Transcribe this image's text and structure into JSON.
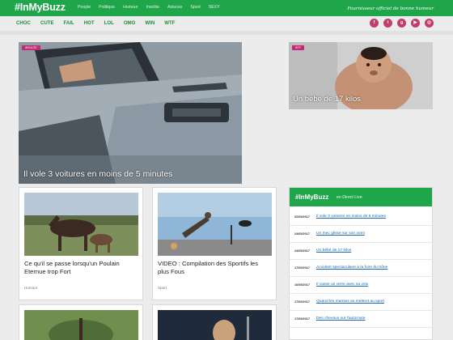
{
  "header": {
    "logo": "#InMyBuzz",
    "nav": [
      "People",
      "Politique",
      "Humour",
      "Insolite",
      "Astuces",
      "Sport",
      "SEXY"
    ],
    "tagline": "Fournisseur officiel de bonne humeur"
  },
  "subnav": [
    "CHOC",
    "CUTE",
    "FAIL",
    "HOT",
    "LOL",
    "OMG",
    "WIN",
    "WTF"
  ],
  "social": [
    {
      "icon": "facebook-icon",
      "glyph": "f"
    },
    {
      "icon": "twitter-icon",
      "glyph": "t"
    },
    {
      "icon": "googleplus-icon",
      "glyph": "g"
    },
    {
      "icon": "youtube-icon",
      "glyph": "▶"
    },
    {
      "icon": "instagram-icon",
      "glyph": "◎"
    }
  ],
  "hero": {
    "badge": "Insolite",
    "title": "Il vole 3 voitures en moins de 5 minutes"
  },
  "side_feature": {
    "badge": "WTF",
    "title": "Un bébé de 17 kilos"
  },
  "cards": [
    {
      "title": "Ce qu'il se passe lorsqu'un Poulain Eternue trop Fort",
      "category": "Humour"
    },
    {
      "title": "VIDEO : Compilation des Sportifs les plus Fous",
      "category": "Sport"
    }
  ],
  "live": {
    "brand": "#InMyBuzz",
    "subtitle": "en Direct Live",
    "items": [
      {
        "date": "02/05/2017",
        "text": "Il vole 3 voitures en moins de 5 minutes"
      },
      {
        "date": "24/05/2017",
        "text": "Un mec glisse sur son vomi"
      },
      {
        "date": "24/05/2017",
        "text": "Un bébé de 17 kilos"
      },
      {
        "date": "17/05/2017",
        "text": "Accident spectaculaire à la foire du trône"
      },
      {
        "date": "16/05/2017",
        "text": "Il casse un verre avec sa voix"
      },
      {
        "date": "17/05/2017",
        "text": "Quand les mamies se mettent au sport"
      },
      {
        "date": "17/05/2017",
        "text": "Des chevaux sur l'autoroute"
      }
    ]
  },
  "colors": {
    "brand": "#1fa64a",
    "badge": "#c22a74",
    "link": "#1565b0",
    "social": "#c33d6a"
  }
}
